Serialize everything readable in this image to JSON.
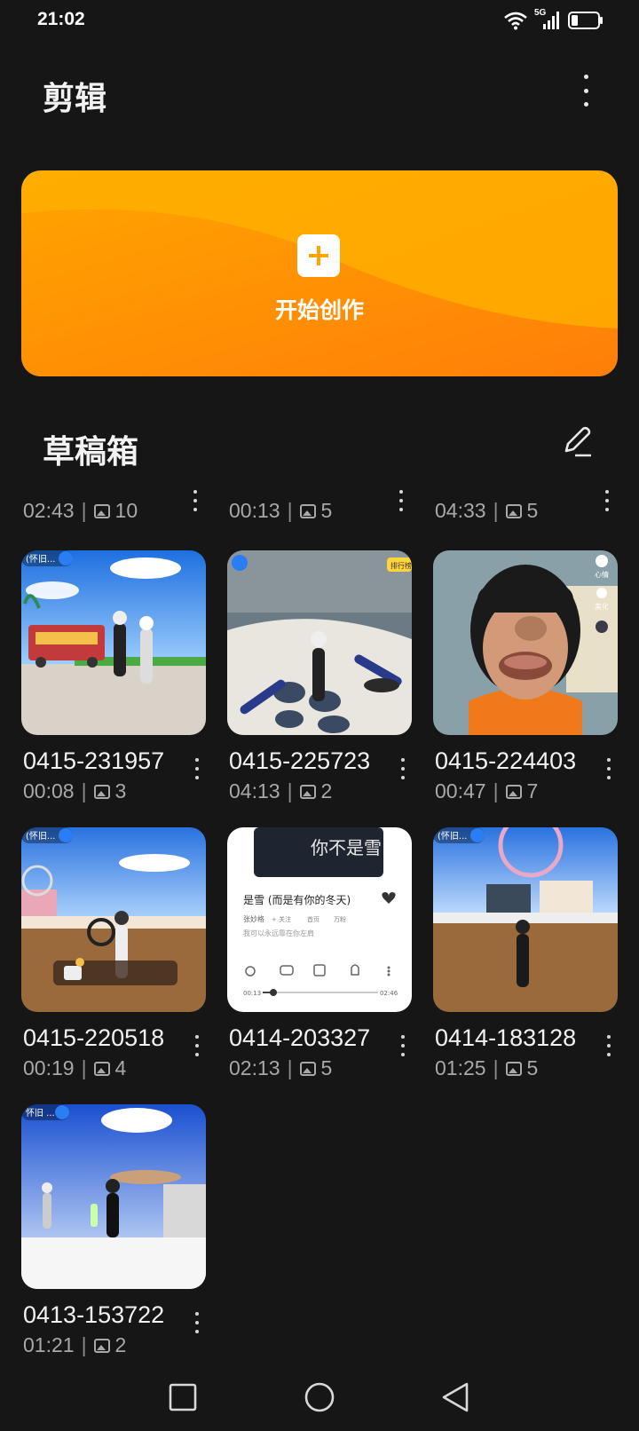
{
  "status": {
    "time": "21:02",
    "network": "5G"
  },
  "header": {
    "title": "剪辑",
    "more_icon": "more-vert-icon"
  },
  "create": {
    "label": "开始创作",
    "icon": "plus-icon"
  },
  "drafts": {
    "title": "草稿箱",
    "edit_icon": "pencil-icon",
    "partial_row": [
      {
        "duration": "02:43",
        "count": "10"
      },
      {
        "duration": "00:13",
        "count": "5"
      },
      {
        "duration": "04:33",
        "count": "5"
      }
    ],
    "items": [
      {
        "name": "0415-231957",
        "duration": "00:08",
        "count": "3"
      },
      {
        "name": "0415-225723",
        "duration": "04:13",
        "count": "2"
      },
      {
        "name": "0415-224403",
        "duration": "00:47",
        "count": "7"
      },
      {
        "name": "0415-220518",
        "duration": "00:19",
        "count": "4"
      },
      {
        "name": "0414-203327",
        "duration": "02:13",
        "count": "5"
      },
      {
        "name": "0414-183128",
        "duration": "01:25",
        "count": "5"
      },
      {
        "name": "0413-153722",
        "duration": "01:21",
        "count": "2"
      }
    ],
    "separator": "|"
  },
  "thumb_text": {
    "t1_tag": "(怀旧...",
    "t2_tag": "排行榜",
    "t3_labels": [
      "心情",
      "美化"
    ],
    "t4_tag": "(怀旧...",
    "t5_cover": "你不是雪",
    "t5_song": "是雪 (而是有你的冬天)",
    "t5_artist": "张妙格",
    "t5_meta": [
      "+ 关注",
      "首页",
      "万粉"
    ],
    "t5_lyric": "我可以永远靠在你左肩",
    "t5_start": "00:13",
    "t5_end": "02:46",
    "t6_tag": "(怀旧...",
    "t7_tag": "怀旧 ..."
  },
  "colors": {
    "accent": "#FFA600",
    "background": "#161616",
    "meta": "#A8A8A8"
  }
}
